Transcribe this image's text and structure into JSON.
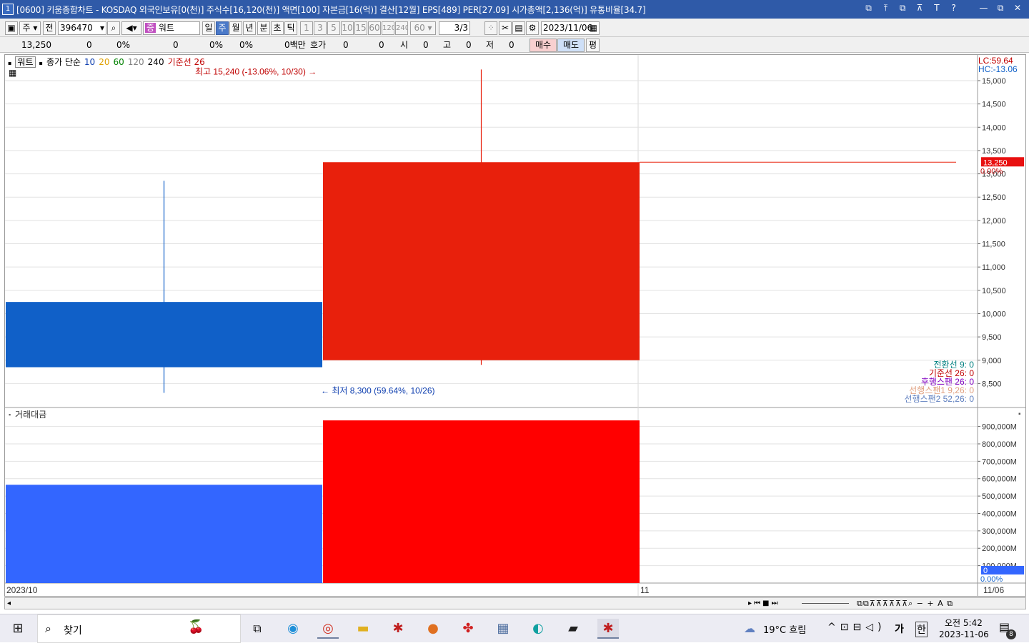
{
  "window": {
    "number": "1",
    "title": "[0600] 키움종합차트 - KOSDAQ 외국인보유[0(천)] 주식수[16,120(천)] 액면[100] 자본금[16(억)] 결산[12월] EPS[489] PER[27.09] 시가총액[2,136(억)] 유통비율[34.7]",
    "title_icons": [
      "⧉",
      "⤒",
      "⧉",
      "⊼",
      "T",
      "?"
    ],
    "controls": [
      "—",
      "⧉",
      "✕"
    ]
  },
  "toolbar": {
    "market": "주",
    "type": "전",
    "code": "396470",
    "stock_name": "워트",
    "periods": [
      "일",
      "주",
      "월",
      "년",
      "분",
      "초",
      "틱"
    ],
    "selected_period": "주",
    "intervals": [
      "1",
      "3",
      "5",
      "10",
      "15",
      "60",
      "120",
      "240",
      "60"
    ],
    "page": "3",
    "page_total": "/3",
    "date": "2023/11/06"
  },
  "quote": {
    "price": "13,250",
    "change": "0",
    "change_pct": "0%",
    "volume": "0",
    "volume_pct": "0%",
    "amount": "0백만",
    "hoga_label": "호가",
    "hoga": "0",
    "hoga2": "0",
    "open_label": "시",
    "open": "0",
    "high_label": "고",
    "high": "0",
    "low_label": "저",
    "low": "0",
    "buy": "매수",
    "sell": "매도",
    "avg": "평"
  },
  "legend": {
    "name": "워트",
    "ma_label": "종가 단순",
    "ma": [
      "10",
      "20",
      "60",
      "120",
      "240"
    ],
    "base": "기준선 26"
  },
  "colors": {
    "up": "#e8200c",
    "down": "#1060c8",
    "vol_up": "#ff0000",
    "vol_down": "#3366ff",
    "ma20": "#e0a000",
    "ma60": "#008000",
    "ma120": "#808080"
  },
  "annotations": {
    "high": "최고 15,240 (-13.06%, 10/30)",
    "low": "최저 8,300 (59.64%, 10/26)",
    "lc": "LC:59.64",
    "hc": "HC:-13.06",
    "price_tag": "13,250",
    "price_pct": "0.00%"
  },
  "ichimoku": [
    {
      "label": "전환선 9: 0",
      "color": "#008080"
    },
    {
      "label": "기준선 26: 0",
      "color": "#c00000"
    },
    {
      "label": "후행스팬 26: 0",
      "color": "#8000c0"
    },
    {
      "label": "선행스팬1 9,26: 0",
      "color": "#e0a080"
    },
    {
      "label": "선행스팬2 52,26: 0",
      "color": "#6080c0"
    }
  ],
  "volume_panel": {
    "title": "거래대금",
    "last": "0",
    "last_pct": "0.00%"
  },
  "x_labels": {
    "left": "2023/10",
    "mid": "11",
    "right": "11/06"
  },
  "chart_data": [
    {
      "type": "candlestick",
      "x": [
        "2023/10 week 4",
        "2023/10/30 week",
        "2023/11/06 week"
      ],
      "ohlc": [
        {
          "open": 10250,
          "high": 12850,
          "low": 8300,
          "close": 8850
        },
        {
          "open": 9000,
          "high": 15240,
          "low": 8900,
          "close": 13250
        },
        {
          "open": 13250,
          "high": 13250,
          "low": 13250,
          "close": 13250
        }
      ],
      "ylim": [
        8000,
        15300
      ],
      "yticks": [
        8500,
        9000,
        9500,
        10000,
        10500,
        11000,
        11500,
        12000,
        12500,
        13000,
        13500,
        14000,
        14500,
        15000
      ]
    },
    {
      "type": "bar",
      "title": "거래대금",
      "categories": [
        "2023/10 week 4",
        "2023/10/30 week",
        "2023/11/06 week"
      ],
      "values": [
        565000,
        935000,
        0
      ],
      "unit": "M",
      "ylim": [
        0,
        960000
      ],
      "yticks": [
        100000,
        200000,
        300000,
        400000,
        500000,
        600000,
        700000,
        800000,
        900000
      ]
    }
  ],
  "taskbar": {
    "search": "찾기",
    "weather": "19°C  흐림",
    "ime": "가",
    "ime2": "한",
    "time": "오전 5:42",
    "date": "2023-11-06",
    "notif": "8"
  }
}
